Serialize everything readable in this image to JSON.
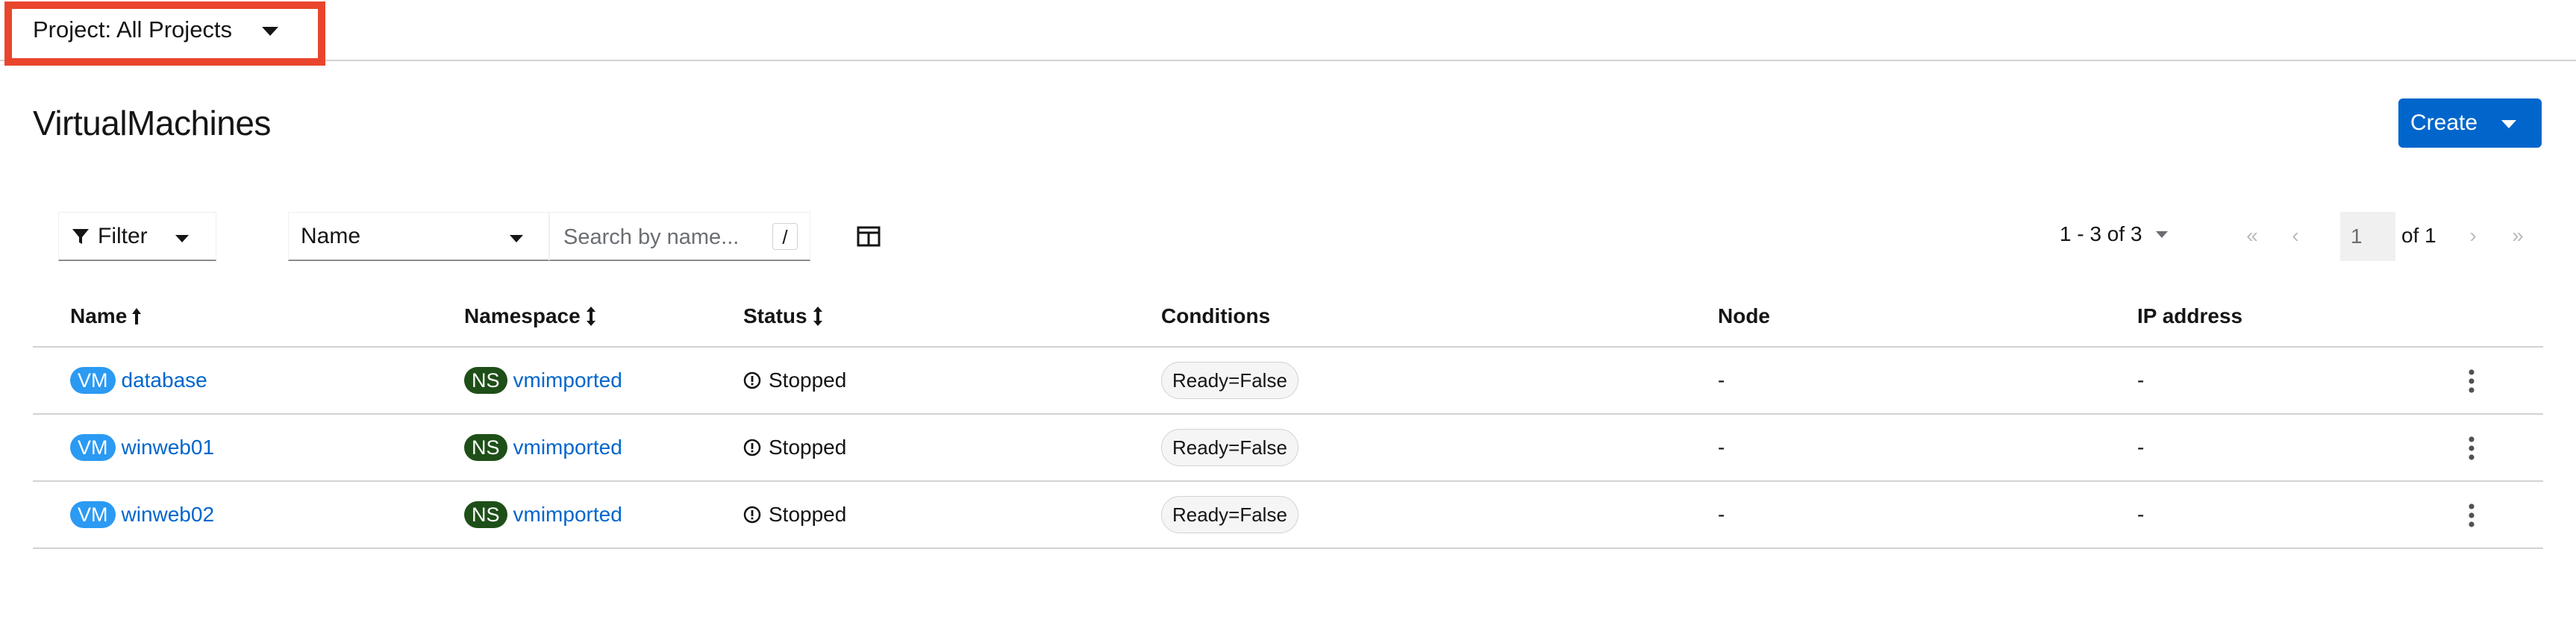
{
  "project_selector": {
    "label": "Project: All Projects"
  },
  "page": {
    "title": "VirtualMachines"
  },
  "create_button": {
    "label": "Create"
  },
  "toolbar": {
    "filter_label": "Filter",
    "name_select": "Name",
    "search_placeholder": "Search by name...",
    "search_shortcut": "/"
  },
  "pagination": {
    "range": "1 - 3 of 3",
    "page": "1",
    "of_label": "of 1"
  },
  "table": {
    "columns": {
      "name": "Name",
      "namespace": "Namespace",
      "status": "Status",
      "conditions": "Conditions",
      "node": "Node",
      "ip": "IP address"
    },
    "rows": [
      {
        "kind_badge": "VM",
        "name": "database",
        "ns_badge": "NS",
        "namespace": "vmimported",
        "status": "Stopped",
        "condition": "Ready=False",
        "node": "-",
        "ip": "-"
      },
      {
        "kind_badge": "VM",
        "name": "winweb01",
        "ns_badge": "NS",
        "namespace": "vmimported",
        "status": "Stopped",
        "condition": "Ready=False",
        "node": "-",
        "ip": "-"
      },
      {
        "kind_badge": "VM",
        "name": "winweb02",
        "ns_badge": "NS",
        "namespace": "vmimported",
        "status": "Stopped",
        "condition": "Ready=False",
        "node": "-",
        "ip": "-"
      }
    ]
  },
  "colors": {
    "primary": "#0066cc",
    "vm_badge": "#2b9af3",
    "ns_badge": "#1e4f18",
    "highlight": "#e9452c"
  }
}
